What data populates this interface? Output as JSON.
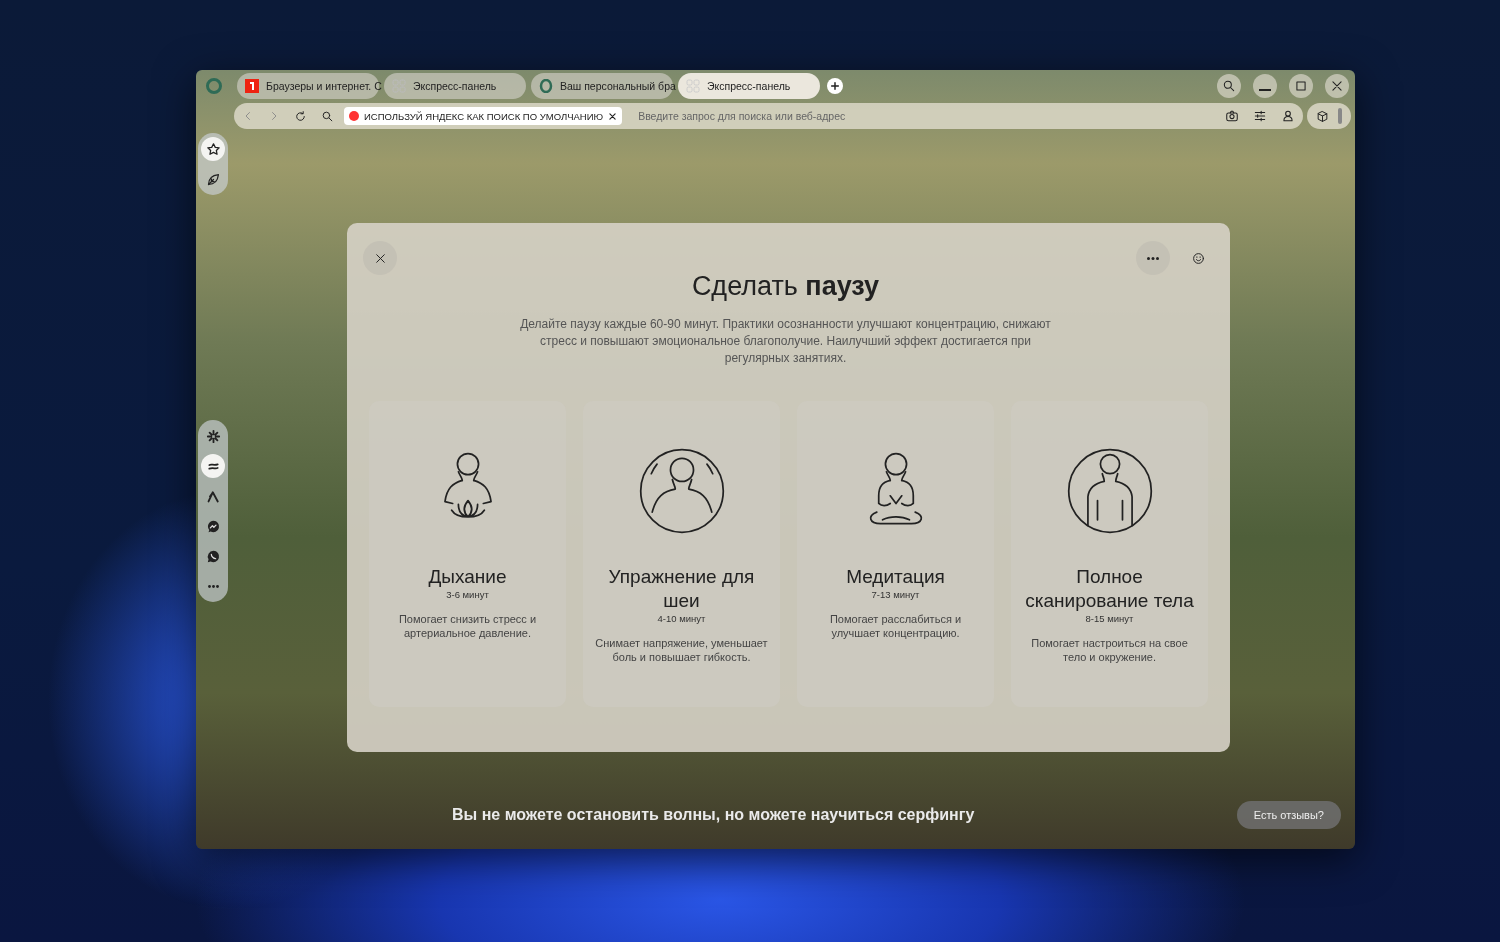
{
  "tabs": [
    {
      "label": "Браузеры и интернет. С",
      "selected": false
    },
    {
      "label": "Экспресс-панель",
      "selected": false
    },
    {
      "label": "Ваш персональный бра",
      "selected": false
    },
    {
      "label": "Экспресс-панель",
      "selected": true
    }
  ],
  "address_bar": {
    "promo": "ИСПОЛЬЗУЙ ЯНДЕКС КАК ПОИСК ПО УМОЛЧАНИЮ",
    "placeholder": "Введите запрос для поиска или веб-адрес"
  },
  "sidebar": {
    "top_items": [
      {
        "selected": true
      },
      {
        "selected": false
      }
    ],
    "bottom_items": [
      {
        "selected": false
      },
      {
        "selected": true
      },
      {
        "selected": false
      },
      {
        "selected": false
      },
      {
        "selected": false
      },
      {
        "selected": false
      }
    ]
  },
  "dialog": {
    "title": "Сделать **паузу**",
    "description": "Делайте паузу каждые 60-90 минут. Практики осознанности улучшают концентрацию, снижают стресс и повышают эмоциональное благополучие. Наилучший эффект достигается при регулярных занятиях.",
    "cards": [
      {
        "kind": "lotus",
        "title": "Дыхание",
        "duration": "3-6 минут",
        "description": "Помогает снизить стресс и артериальное давление."
      },
      {
        "kind": "neck",
        "title": "Упражнение для шеи",
        "duration": "4-10 минут",
        "description": "Снимает напряжение, уменьшает боль и повышает гибкость."
      },
      {
        "kind": "meditation",
        "title": "Медитация",
        "duration": "7-13 минут",
        "description": "Помогает расслабиться и улучшает концентрацию."
      },
      {
        "kind": "body",
        "title": "Полное сканирование тела",
        "duration": "8-15 минут",
        "description": "Помогает настроиться на свое тело и окружение."
      }
    ]
  },
  "quote": "Вы не можете остановить волны, но можете научиться серфингу",
  "feedback_button": "Есть отзывы?"
}
